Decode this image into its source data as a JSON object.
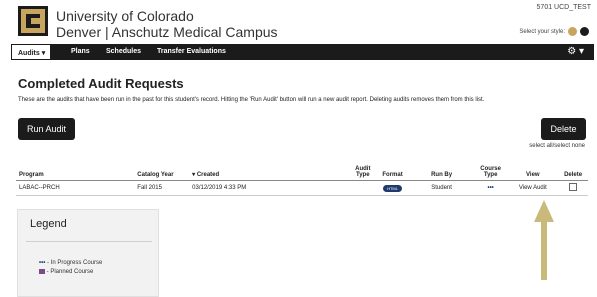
{
  "header": {
    "univ_line1": "University of Colorado",
    "univ_line2": "Denver | Anschutz Medical Campus",
    "user_id": "5701 UCD_TEST",
    "style_label": "Select your style:",
    "style_colors": [
      "#c8a55e",
      "#1b1b1b"
    ]
  },
  "nav": {
    "items": [
      "Audits ▾",
      "Plans",
      "Schedules",
      "Transfer Evaluations"
    ],
    "gear_label": "⚙ ▾"
  },
  "page": {
    "title": "Completed Audit Requests",
    "description": "These are the audits that have been run in the past for this student's record. Hitting the 'Run Audit' button will run a new audit report. Deleting audits removes them from this list.",
    "run_audit": "Run Audit",
    "delete": "Delete",
    "select_all": "select all/select none"
  },
  "table": {
    "headers": [
      "Program",
      "Catalog Year",
      "▾ Created",
      "Audit Type",
      "Format",
      "Run By",
      "Course Type",
      "View",
      "Delete"
    ],
    "rows": [
      {
        "program": "LABAC--PRCH",
        "catalog_year": "Fall 2015",
        "created": "03/12/2019 4:33 PM",
        "audit_type": "",
        "format": "HTML",
        "run_by": "Student",
        "course_type": "•••",
        "view": "View Audit"
      }
    ]
  },
  "legend": {
    "title": "Legend",
    "items": [
      {
        "symbol": "•••",
        "label": "- In Progress Course"
      },
      {
        "symbol": "",
        "label": "- Planned Course"
      }
    ]
  },
  "colors": {
    "accent": "#1f3b6e",
    "dark": "#1b1b1b",
    "gold": "#c8a55e",
    "arrow": "#c9b97a"
  }
}
